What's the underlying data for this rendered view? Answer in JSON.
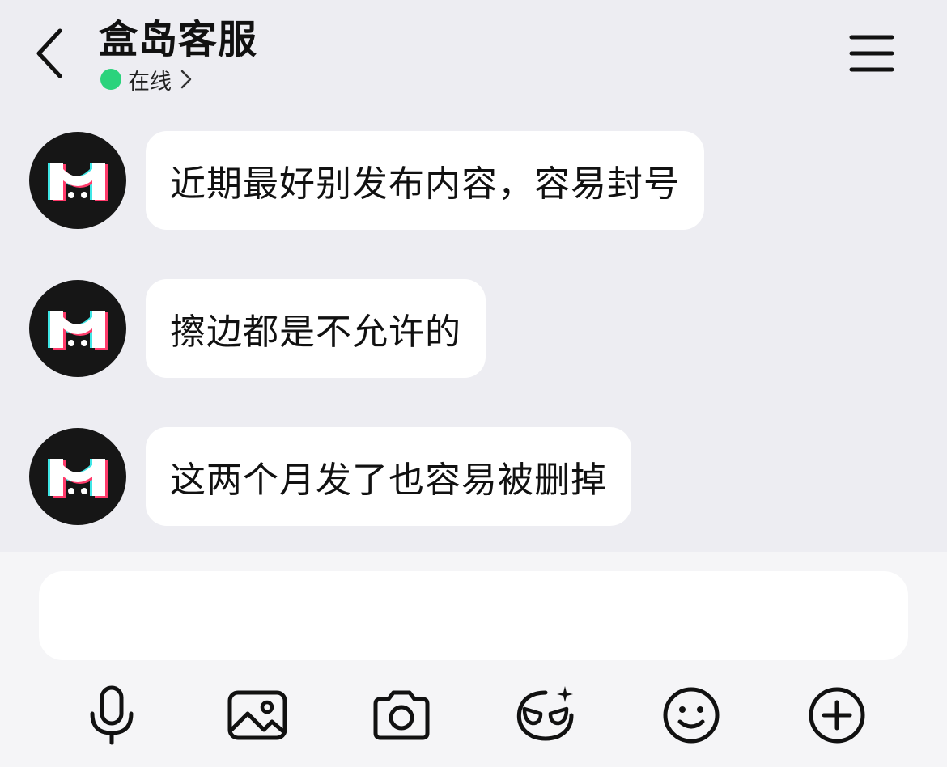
{
  "header": {
    "title": "盒岛客服",
    "status_text": "在线",
    "status_color": "#2bd37c"
  },
  "messages": [
    {
      "text": "近期最好别发布内容，容易封号"
    },
    {
      "text": "擦边都是不允许的"
    },
    {
      "text": "这两个月发了也容易被删掉"
    }
  ],
  "input": {
    "value": "",
    "placeholder": ""
  },
  "toolbar": {
    "icons": [
      "microphone-icon",
      "image-icon",
      "camera-icon",
      "ai-mask-icon",
      "emoji-icon",
      "plus-circle-icon"
    ]
  },
  "colors": {
    "background": "#ededf2",
    "bubble": "#ffffff",
    "avatar": "#161616",
    "accent_cyan": "#3fe6e6",
    "accent_pink": "#ff3b6b"
  }
}
